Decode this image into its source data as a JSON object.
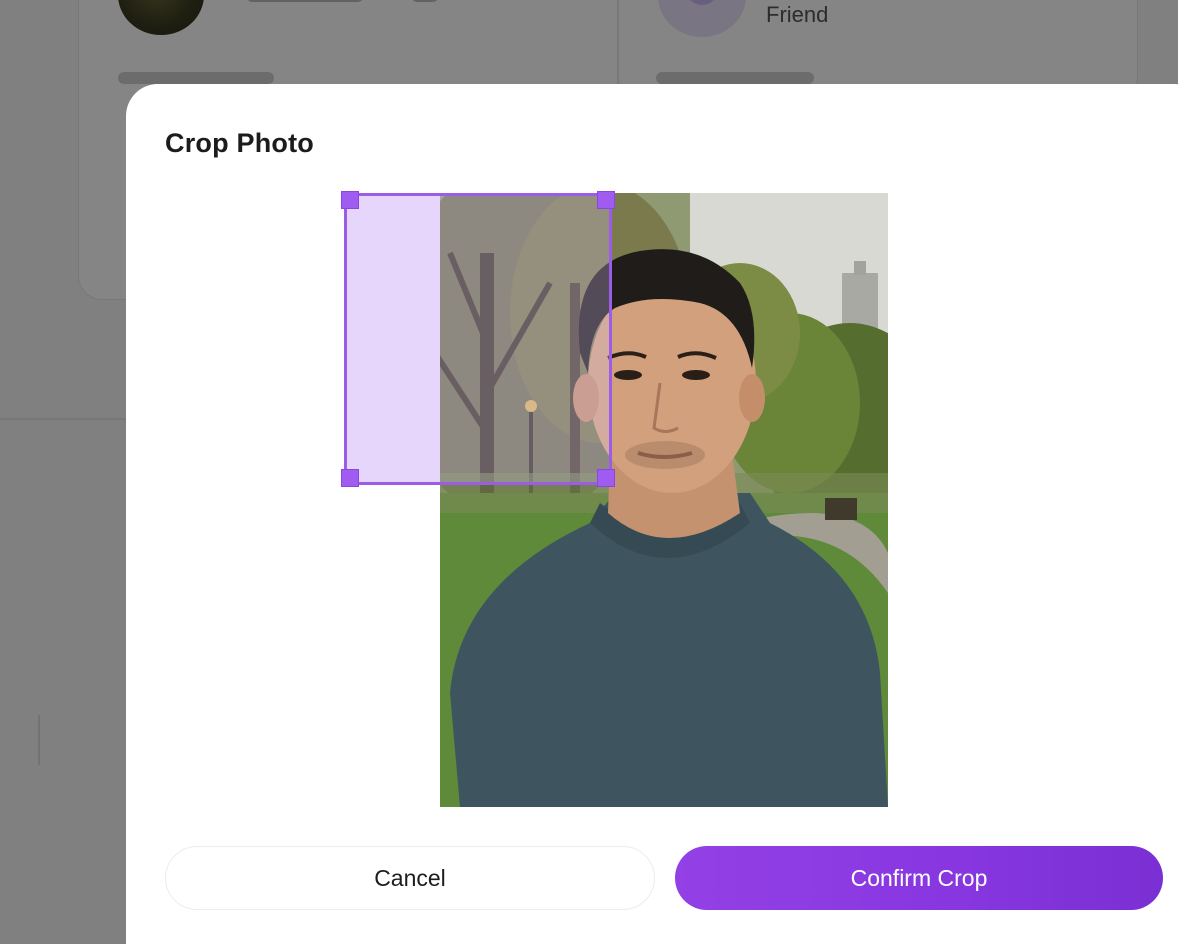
{
  "background": {
    "friend_label": "Friend"
  },
  "modal": {
    "title": "Crop Photo",
    "cancel_label": "Cancel",
    "confirm_label": "Confirm Crop"
  },
  "colors": {
    "accent": "#9340e6",
    "crop_border": "#9b5de5",
    "crop_handle": "#a05cf0"
  },
  "icons": {
    "crop_handles": [
      "crop-handle-top-left",
      "crop-handle-top-right",
      "crop-handle-bottom-left",
      "crop-handle-bottom-right"
    ]
  }
}
